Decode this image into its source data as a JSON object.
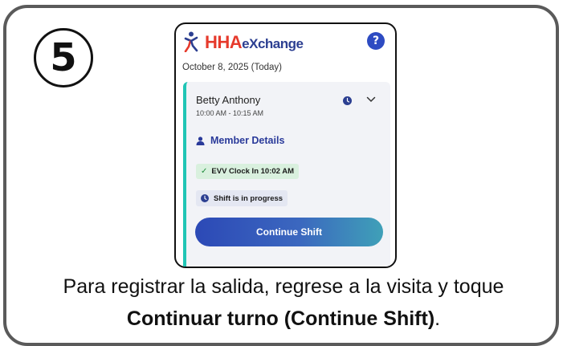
{
  "step_number": "5",
  "app": {
    "brand_hha": "HHA",
    "brand_exchange": "eXchange",
    "help_label": "?",
    "logo_icon": "person-wheelchair-icon",
    "brand_color": "#e63a2c"
  },
  "date_label": "October 8, 2025 (Today)",
  "visit": {
    "member_name": "Betty Anthony",
    "time_range": "10:00 AM - 10:15 AM",
    "member_details_label": "Member Details",
    "evv_badge": "EVV Clock In 10:02 AM",
    "status_badge": "Shift is in progress",
    "continue_button": "Continue Shift",
    "accent_color": "#20c5b5"
  },
  "caption": {
    "line1": "Para registrar la salida, regrese a la visita y toque",
    "line2_bold": "Continuar turno (Continue Shift)",
    "line2_end": "."
  }
}
